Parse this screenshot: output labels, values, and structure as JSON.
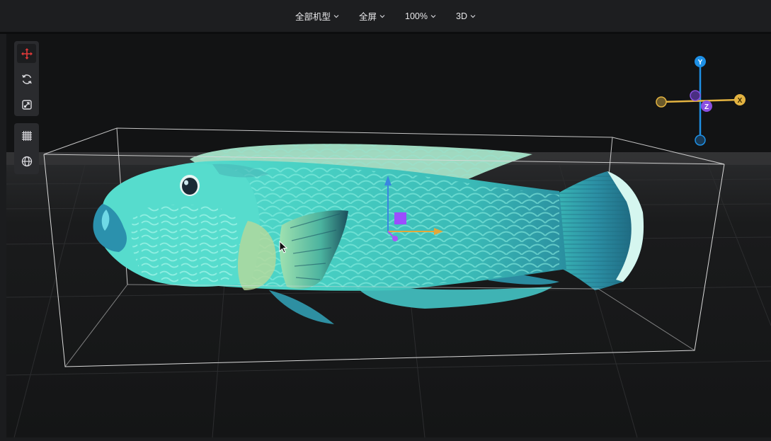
{
  "toolbar": {
    "menus": [
      {
        "label": "全部机型"
      },
      {
        "label": "全屏"
      },
      {
        "label": "100%"
      },
      {
        "label": "3D"
      }
    ]
  },
  "tools": {
    "transform": [
      {
        "name": "move",
        "icon": "move-icon",
        "active": true
      },
      {
        "name": "rotate",
        "icon": "rotate-icon",
        "active": false
      },
      {
        "name": "scale",
        "icon": "scale-icon",
        "active": false
      }
    ],
    "view": [
      {
        "name": "grid",
        "icon": "grid-icon"
      },
      {
        "name": "world",
        "icon": "globe-icon"
      }
    ]
  },
  "gizmo": {
    "x_label": "X",
    "y_label": "Y",
    "z_label": "Z",
    "x_color": "#e3b341",
    "y_color": "#1e90e6",
    "z_color": "#8a4fe0"
  },
  "colors": {
    "active_tool": "#e23a3a",
    "model_body": "#4fd1c5",
    "selection_box": "#d9d9d9"
  }
}
